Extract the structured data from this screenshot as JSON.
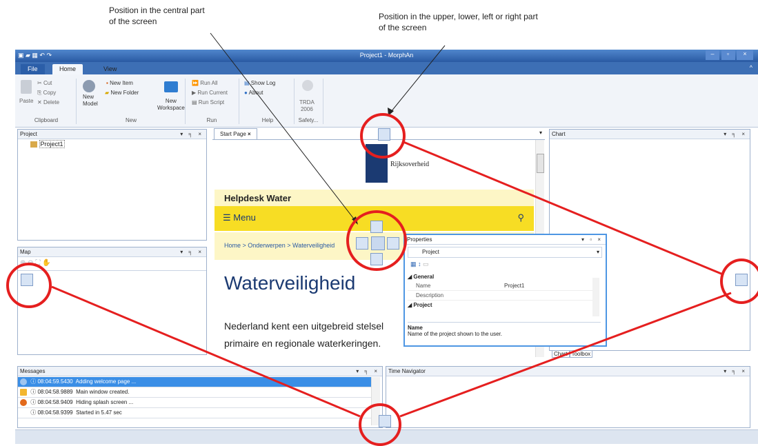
{
  "annotations": {
    "central": "Position in the central part\nof the screen",
    "edges": "Position in the upper, lower, left or right part\nof the screen"
  },
  "window": {
    "title": "Project1 - MorphAn"
  },
  "ribbon_tabs": [
    "File",
    "Home",
    "View"
  ],
  "ribbon": {
    "clipboard": {
      "paste": "Paste",
      "cut": "Cut",
      "copy": "Copy",
      "delete": "Delete",
      "label": "Clipboard"
    },
    "new": {
      "new_model_1": "New",
      "new_model_2": "Model",
      "new_item": "New Item",
      "new_folder": "New Folder",
      "new_ws_1": "New",
      "new_ws_2": "Workspace",
      "label": "New"
    },
    "run": {
      "run_all": "Run All",
      "run_current": "Run Current",
      "run_script": "Run Script",
      "label": "Run"
    },
    "help": {
      "show_log": "Show Log",
      "about": "About",
      "label": "Help"
    },
    "safety": {
      "l1": "TRDA",
      "l2": "2006",
      "label": "Safety..."
    }
  },
  "project_panel": {
    "title": "Project",
    "controls": "▾ ╕ ×",
    "item": "Project1"
  },
  "map_panel": {
    "title": "Map",
    "controls": "▾ ╕ ×"
  },
  "start_page": {
    "tab": "Start Page",
    "logo_text": "Rijksoverheid",
    "banner": "Helpdesk Water",
    "menu": "Menu",
    "breadcrumb": "Home > Onderwerpen > Waterveiligheid",
    "heading": "Waterveiligheid",
    "para1": "Nederland kent een uitgebreid stelsel",
    "para2": "primaire en regionale waterkeringen."
  },
  "chart_panel": {
    "title": "Chart",
    "controls": "▾ ╕ ×",
    "bottom_tabs": [
      "Chart",
      "Toolbox"
    ]
  },
  "properties": {
    "title": "Properties",
    "controls": "▾ ▫ ×",
    "selector": "Project",
    "rows": [
      {
        "name": "General",
        "value": "",
        "category": true
      },
      {
        "name": "Name",
        "value": "Project1",
        "category": false
      },
      {
        "name": "Description",
        "value": "",
        "category": false
      },
      {
        "name": "Project",
        "value": "",
        "category": true
      }
    ],
    "desc_title": "Name",
    "desc_text": "Name of the project shown to the user."
  },
  "messages": {
    "title": "Messages",
    "controls": "▾ ╕ ×",
    "rows": [
      {
        "time": "08:04:59.5430",
        "text": "Adding welcome page ...",
        "kind": "info",
        "sel": true
      },
      {
        "time": "08:04:58.9889",
        "text": "Main window created.",
        "kind": "warn",
        "sel": false
      },
      {
        "time": "08:04:58.9409",
        "text": "Hiding splash screen ...",
        "kind": "error",
        "sel": false
      },
      {
        "time": "08:04:58.9399",
        "text": "Started in 5.47 sec",
        "kind": "none",
        "sel": false
      }
    ]
  },
  "time_navigator": {
    "title": "Time Navigator",
    "controls": "▾ ╕ ×"
  },
  "colors": {
    "accent": "#2a5aa3",
    "highlight": "#e51f1f",
    "banner_yellow": "#f7dd24",
    "banner_pale": "#fdf6c6"
  }
}
